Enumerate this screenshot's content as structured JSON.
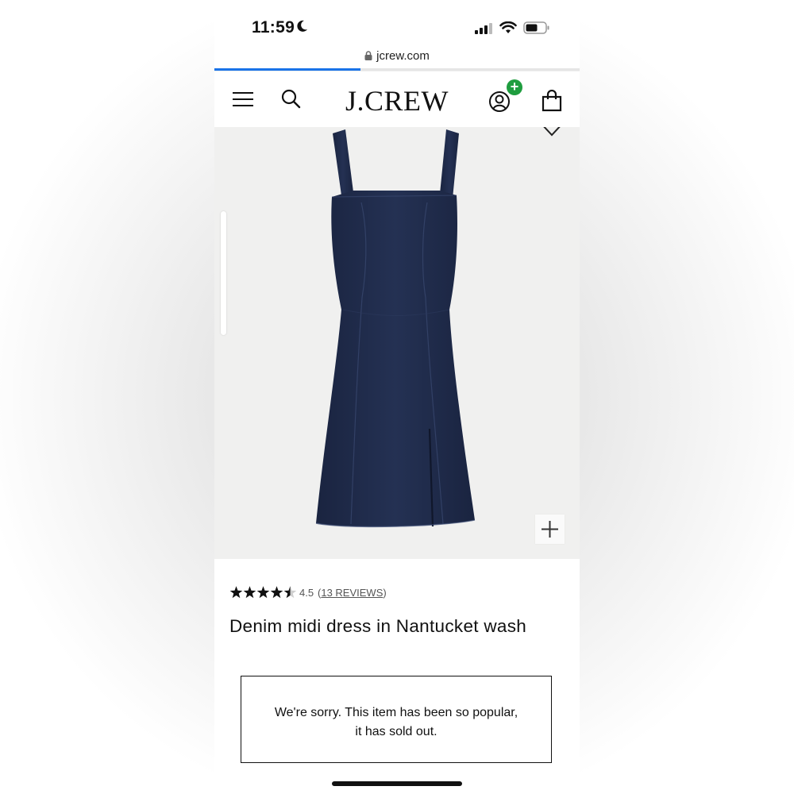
{
  "status_bar": {
    "time": "11:59",
    "moon_icon": "moon-icon",
    "signal_icon": "cellular-signal-icon",
    "wifi_icon": "wifi-icon",
    "battery_icon": "battery-icon"
  },
  "browser": {
    "url": "jcrew.com",
    "lock_icon": "lock-icon",
    "load_progress": 0.4,
    "accent": "#1a73e8"
  },
  "header": {
    "brand": "J.CREW",
    "menu_icon": "hamburger-menu-icon",
    "search_icon": "search-icon",
    "account_icon": "account-icon",
    "account_badge": "+",
    "badge_color": "#1f9d3f",
    "bag_icon": "shopping-bag-icon"
  },
  "product": {
    "image": "denim-midi-dress-image",
    "favorite_icon": "heart-icon",
    "zoom_icon": "plus-icon",
    "dress_color": "#1e2a47",
    "rating_value": 4.5,
    "rating_text": "4.5",
    "reviews_open": "(",
    "reviews_link": "13 REVIEWS",
    "reviews_close": ")",
    "name": "Denim midi dress in Nantucket wash",
    "sold_out_message": "We're sorry. This item has been so popular, it has sold out."
  }
}
